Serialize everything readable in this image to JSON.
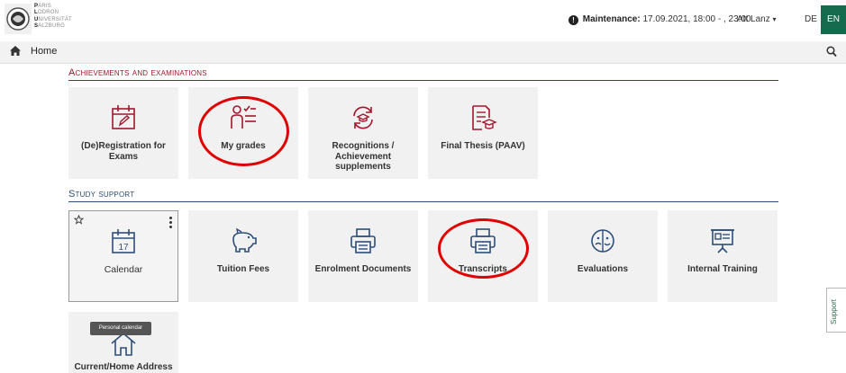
{
  "header": {
    "logo_lines": [
      {
        "initial": "P",
        "rest": "ARIS"
      },
      {
        "initial": "L",
        "rest": "ODRON"
      },
      {
        "initial": "U",
        "rest": "NIVERSITÄT"
      },
      {
        "initial": "S",
        "rest": "ALZBURG"
      }
    ],
    "maintenance_label": "Maintenance:",
    "maintenance_text": "17.09.2021, 18:00 - , 23:00",
    "user_name": "Att Lanz",
    "lang_de": "DE",
    "lang_en": "EN",
    "accent_color": "#156b4d"
  },
  "nav": {
    "home_label": "Home"
  },
  "sections": {
    "achievements": {
      "title": "Achievements and examinations",
      "color": "#a3162c",
      "tiles": [
        {
          "label": "(De)Registration for Exams",
          "icon": "calendar-edit-icon"
        },
        {
          "label": "My grades",
          "icon": "grades-person-icon"
        },
        {
          "label": "Recognitions / Achievement supplements",
          "icon": "recognition-icon"
        },
        {
          "label": "Final Thesis (PAAV)",
          "icon": "thesis-icon"
        }
      ]
    },
    "study_support": {
      "title": "Study support",
      "color": "#2e4e7a",
      "tiles": [
        {
          "label": "Calendar",
          "icon": "calendar-icon",
          "day": "17"
        },
        {
          "label": "Tuition Fees",
          "icon": "piggy-bank-icon"
        },
        {
          "label": "Enrolment Documents",
          "icon": "printer-icon"
        },
        {
          "label": "Transcripts",
          "icon": "printer-icon"
        },
        {
          "label": "Evaluations",
          "icon": "evaluation-icon"
        },
        {
          "label": "Internal Training",
          "icon": "presentation-icon"
        },
        {
          "label": "Current/Home Address",
          "icon": "home-icon"
        }
      ]
    }
  },
  "tooltip": "Personal calendar",
  "support_label": "Support",
  "highlight_color": "#e10000"
}
